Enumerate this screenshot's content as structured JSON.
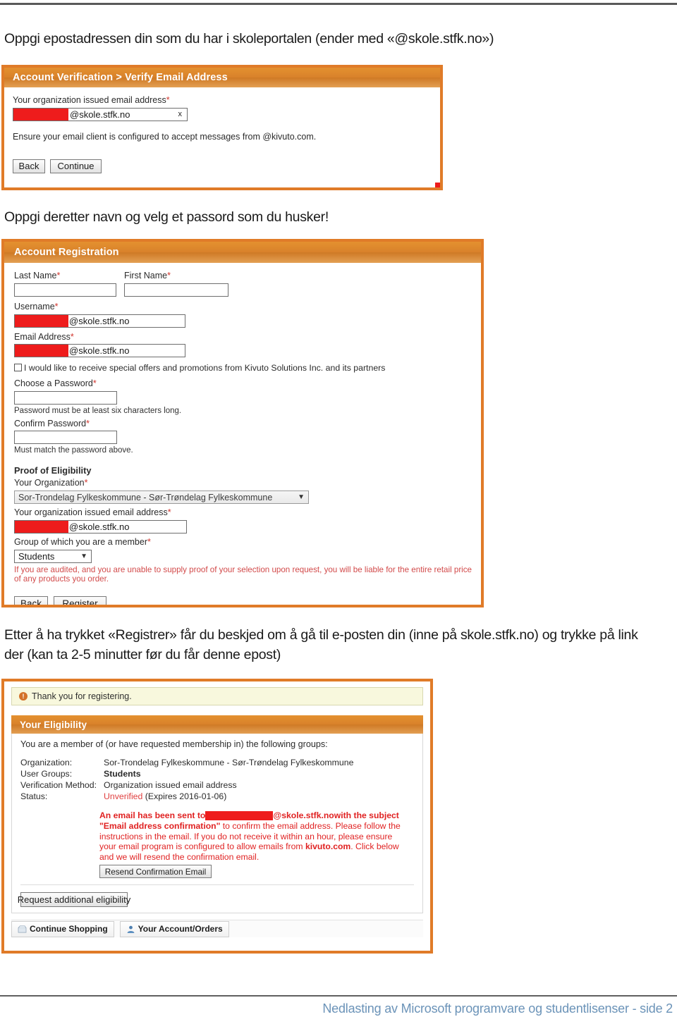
{
  "page": {
    "footer_text": "Nedlasting av Microsoft programvare og studentlisenser - side 2",
    "intro_line": "Oppgi epostadressen din som du har i skoleportalen (ender med «@skole.stfk.no»)",
    "second_line": "Oppgi deretter navn og velg et passord som du husker!",
    "third_line_1": "Etter å ha trykket «Registrer» får du beskjed om å gå til e-posten din (inne på skole.stfk.no) og trykke på link",
    "third_line_2": "der (kan ta 2-5 minutter før du får denne epost)"
  },
  "colors": {
    "accent_orange": "#e07b28",
    "bar_orange": "#d9822b",
    "redaction_red": "#ee1c1c",
    "error_red": "#e02222",
    "footer_blue": "#6b93b8",
    "alert_bg": "#f8f8dd"
  },
  "shot1": {
    "title": "Account Verification > Verify Email Address",
    "email_label": "Your organization issued email address",
    "required_mark": "*",
    "email_domain": "@skole.stfk.no",
    "clear_icon": "x",
    "ensure_text": "Ensure your email client is configured to accept messages from @kivuto.com.",
    "back_label": "Back",
    "continue_label": "Continue"
  },
  "shot2": {
    "title": "Account Registration",
    "last_name_label": "Last Name",
    "first_name_label": "First Name",
    "username_label": "Username",
    "username_domain": "@skole.stfk.no",
    "email_label": "Email Address",
    "email_domain": "@skole.stfk.no",
    "offers_checkbox_label": "I would like to receive special offers and promotions from Kivuto Solutions Inc. and its partners",
    "choose_password_label": "Choose a Password",
    "password_hint": "Password must be at least six characters long.",
    "confirm_password_label": "Confirm Password",
    "confirm_hint": "Must match the password above.",
    "proof_heading": "Proof of Eligibility",
    "organization_label": "Your Organization",
    "organization_value": "Sor-Trondelag Fylkeskommune - Sør-Trøndelag Fylkeskommune",
    "org_email_label": "Your organization issued email address",
    "org_email_domain": "@skole.stfk.no",
    "group_label": "Group of which you are a member",
    "group_value": "Students",
    "audit_warning": "If you are audited, and you are unable to supply proof of your selection upon request, you will be liable for the entire retail price of any products you order.",
    "back_label": "Back",
    "register_label": "Register"
  },
  "shot3": {
    "alert_text": "Thank you for registering.",
    "alert_icon_glyph": "!",
    "panel_title": "Your Eligibility",
    "intro": "You are a member of (or have requested membership in) the following groups:",
    "rows": [
      {
        "key": "Organization:",
        "value": "Sor-Trondelag Fylkeskommune - Sør-Trøndelag Fylkeskommune",
        "bold": false
      },
      {
        "key": "User Groups:",
        "value": "Students",
        "bold": true
      },
      {
        "key": "Verification Method:",
        "value": "Organization issued email address",
        "bold": false
      }
    ],
    "status_key": "Status:",
    "status_value": "Unverified",
    "status_expiry": "(Expires 2016-01-06)",
    "message": {
      "line1_a": "An email has been sent to ",
      "line1_domain": "@skole.stfk.no",
      "line1_b": " with the subject",
      "line2_bold": "\"Email address confirmation\"",
      "line2_rest": " to confirm the email address. Please follow the",
      "line3": "instructions in the email. If you do not receive it within an hour, please ensure",
      "line4_a": "your email program is configured to allow emails from ",
      "line4_bold": "kivuto.com",
      "line4_b": ". Click below",
      "line5": "and we will resend the confirmation email."
    },
    "resend_label": "Resend Confirmation Email",
    "request_label": "Request additional eligibility",
    "continue_shopping_label": "Continue Shopping",
    "account_orders_label": "Your Account/Orders"
  }
}
